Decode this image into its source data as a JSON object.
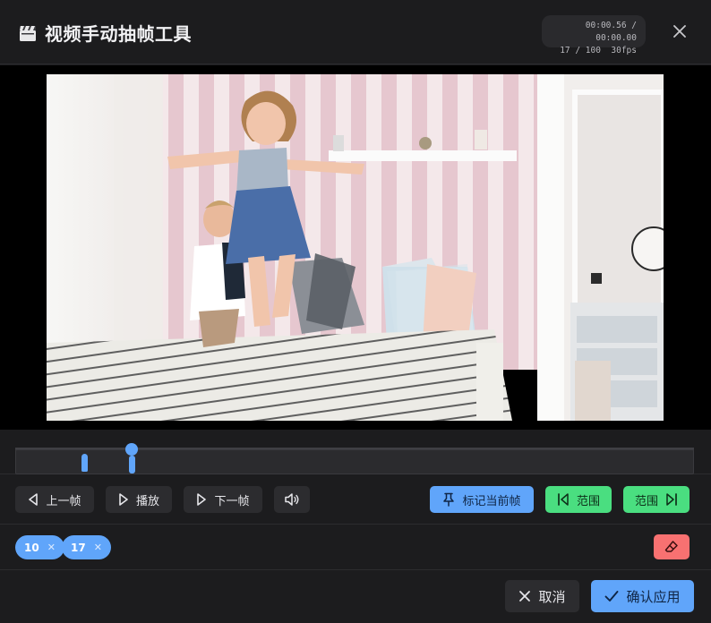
{
  "header": {
    "title": "视频手动抽帧工具",
    "time_line": "00:00.56 / 00:00.00",
    "frame_line": "17 / 100  30fps"
  },
  "video": {
    "scene": "two-children-jumping-on-bed"
  },
  "timeline": {
    "current_frame": 17,
    "total_frames": 100,
    "marked_frames": [
      10,
      17
    ]
  },
  "controls": {
    "prev_label": "上一帧",
    "play_label": "播放",
    "next_label": "下一帧",
    "mark_label": "标记当前帧",
    "range_start_label": "范围",
    "range_end_label": "范围"
  },
  "tags": [
    {
      "label": "10"
    },
    {
      "label": "17"
    }
  ],
  "footer": {
    "cancel_label": "取消",
    "apply_label": "确认应用"
  },
  "colors": {
    "accent_blue": "#60a5fa",
    "accent_green": "#4ade80",
    "danger_red": "#f87171",
    "panel": "#1c1c1e",
    "button_dark": "#2c2c2f"
  }
}
